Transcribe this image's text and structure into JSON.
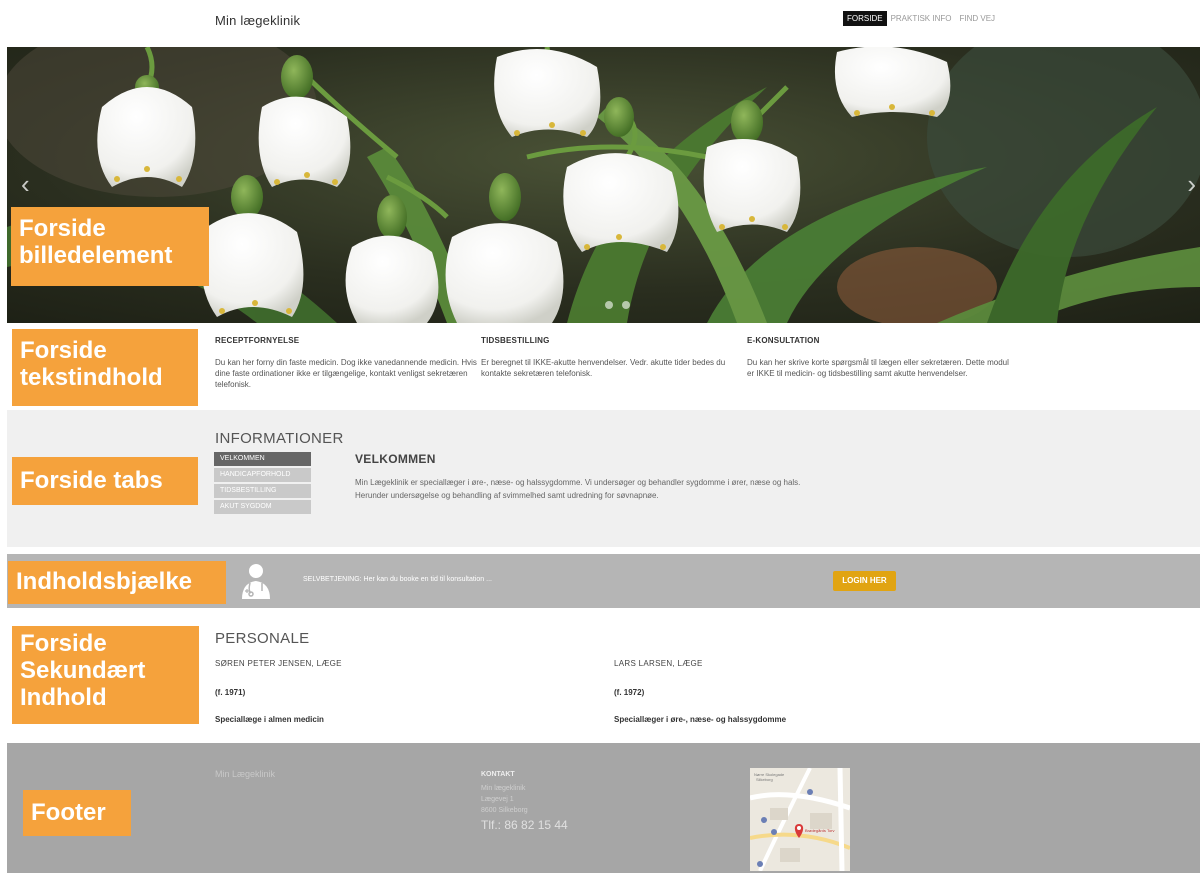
{
  "header": {
    "site_title": "Min lægeklinik",
    "nav": [
      "FORSIDE",
      "PRAKTISK INFO",
      "FIND VEJ"
    ]
  },
  "hero": {
    "prev_icon": "chevron-left-icon",
    "next_icon": "chevron-right-icon",
    "slide_count": 2,
    "active_slide": 1
  },
  "annotations": {
    "hero": [
      "Forside",
      "billedelement"
    ],
    "text": [
      "Forside",
      "tekstindhold"
    ],
    "tabs": [
      "Forside tabs"
    ],
    "bar": [
      "Indholdsbjælke"
    ],
    "secondary": [
      "Forside",
      "Sekundært",
      "Indhold"
    ],
    "footer": [
      "Footer"
    ],
    "color": "#f5a23c"
  },
  "columns": [
    {
      "heading": "RECEPTFORNYELSE",
      "text": "Du kan her forny din faste medicin. Dog ikke vanedannende medicin. Hvis dine faste ordinationer ikke er tilgængelige, kontakt venligst sekretæren telefonisk."
    },
    {
      "heading": "TIDSBESTILLING",
      "text": "Er beregnet til IKKE-akutte henvendelser. Vedr. akutte tider bedes du kontakte sekretæren telefonisk."
    },
    {
      "heading": "E-KONSULTATION",
      "text": "Du kan her skrive korte spørgsmål til lægen eller sekretæren. Dette modul er IKKE til medicin- og tidsbestilling samt akutte henvendelser."
    }
  ],
  "tabs": {
    "heading": "INFORMATIONER",
    "items": [
      "VELKOMMEN",
      "HANDICAPFORHOLD",
      "TIDSBESTILLING",
      "AKUT SYGDOM"
    ],
    "active": 0,
    "content_title": "VELKOMMEN",
    "content_lines": [
      "Min Lægeklinik er speciallæger i øre-, næse- og halssygdomme. Vi undersøger og behandler sygdomme i ører, næse og hals.",
      "Herunder undersøgelse og behandling af svimmelhed samt udredning for søvnapnøe."
    ]
  },
  "bar": {
    "icon": "doctor-icon",
    "text": "SELVBETJENING: Her kan du booke en tid til konsultation ...",
    "button": "LOGIN HER",
    "button_color": "#e1a412"
  },
  "staff": {
    "heading": "PERSONALE",
    "people": [
      {
        "name": "SØREN PETER JENSEN, LÆGE",
        "year": "(f. 1971)",
        "spec": "Speciallæge i almen medicin"
      },
      {
        "name": "LARS LARSEN, LÆGE",
        "year": "(f. 1972)",
        "spec": "Speciallæger i øre-, næse- og halssygdomme"
      }
    ]
  },
  "footer": {
    "brand": "Min Lægeklinik",
    "contact_heading": "KONTAKT",
    "address": [
      "Min lægeklinik",
      "Lægevej 1",
      "8600 Silkeborg"
    ],
    "phone": "Tlf.: 86 82 15 44",
    "map_labels": [
      "Nørre Skolegade",
      "Silkeborg",
      "Brødegårds Torv"
    ]
  }
}
